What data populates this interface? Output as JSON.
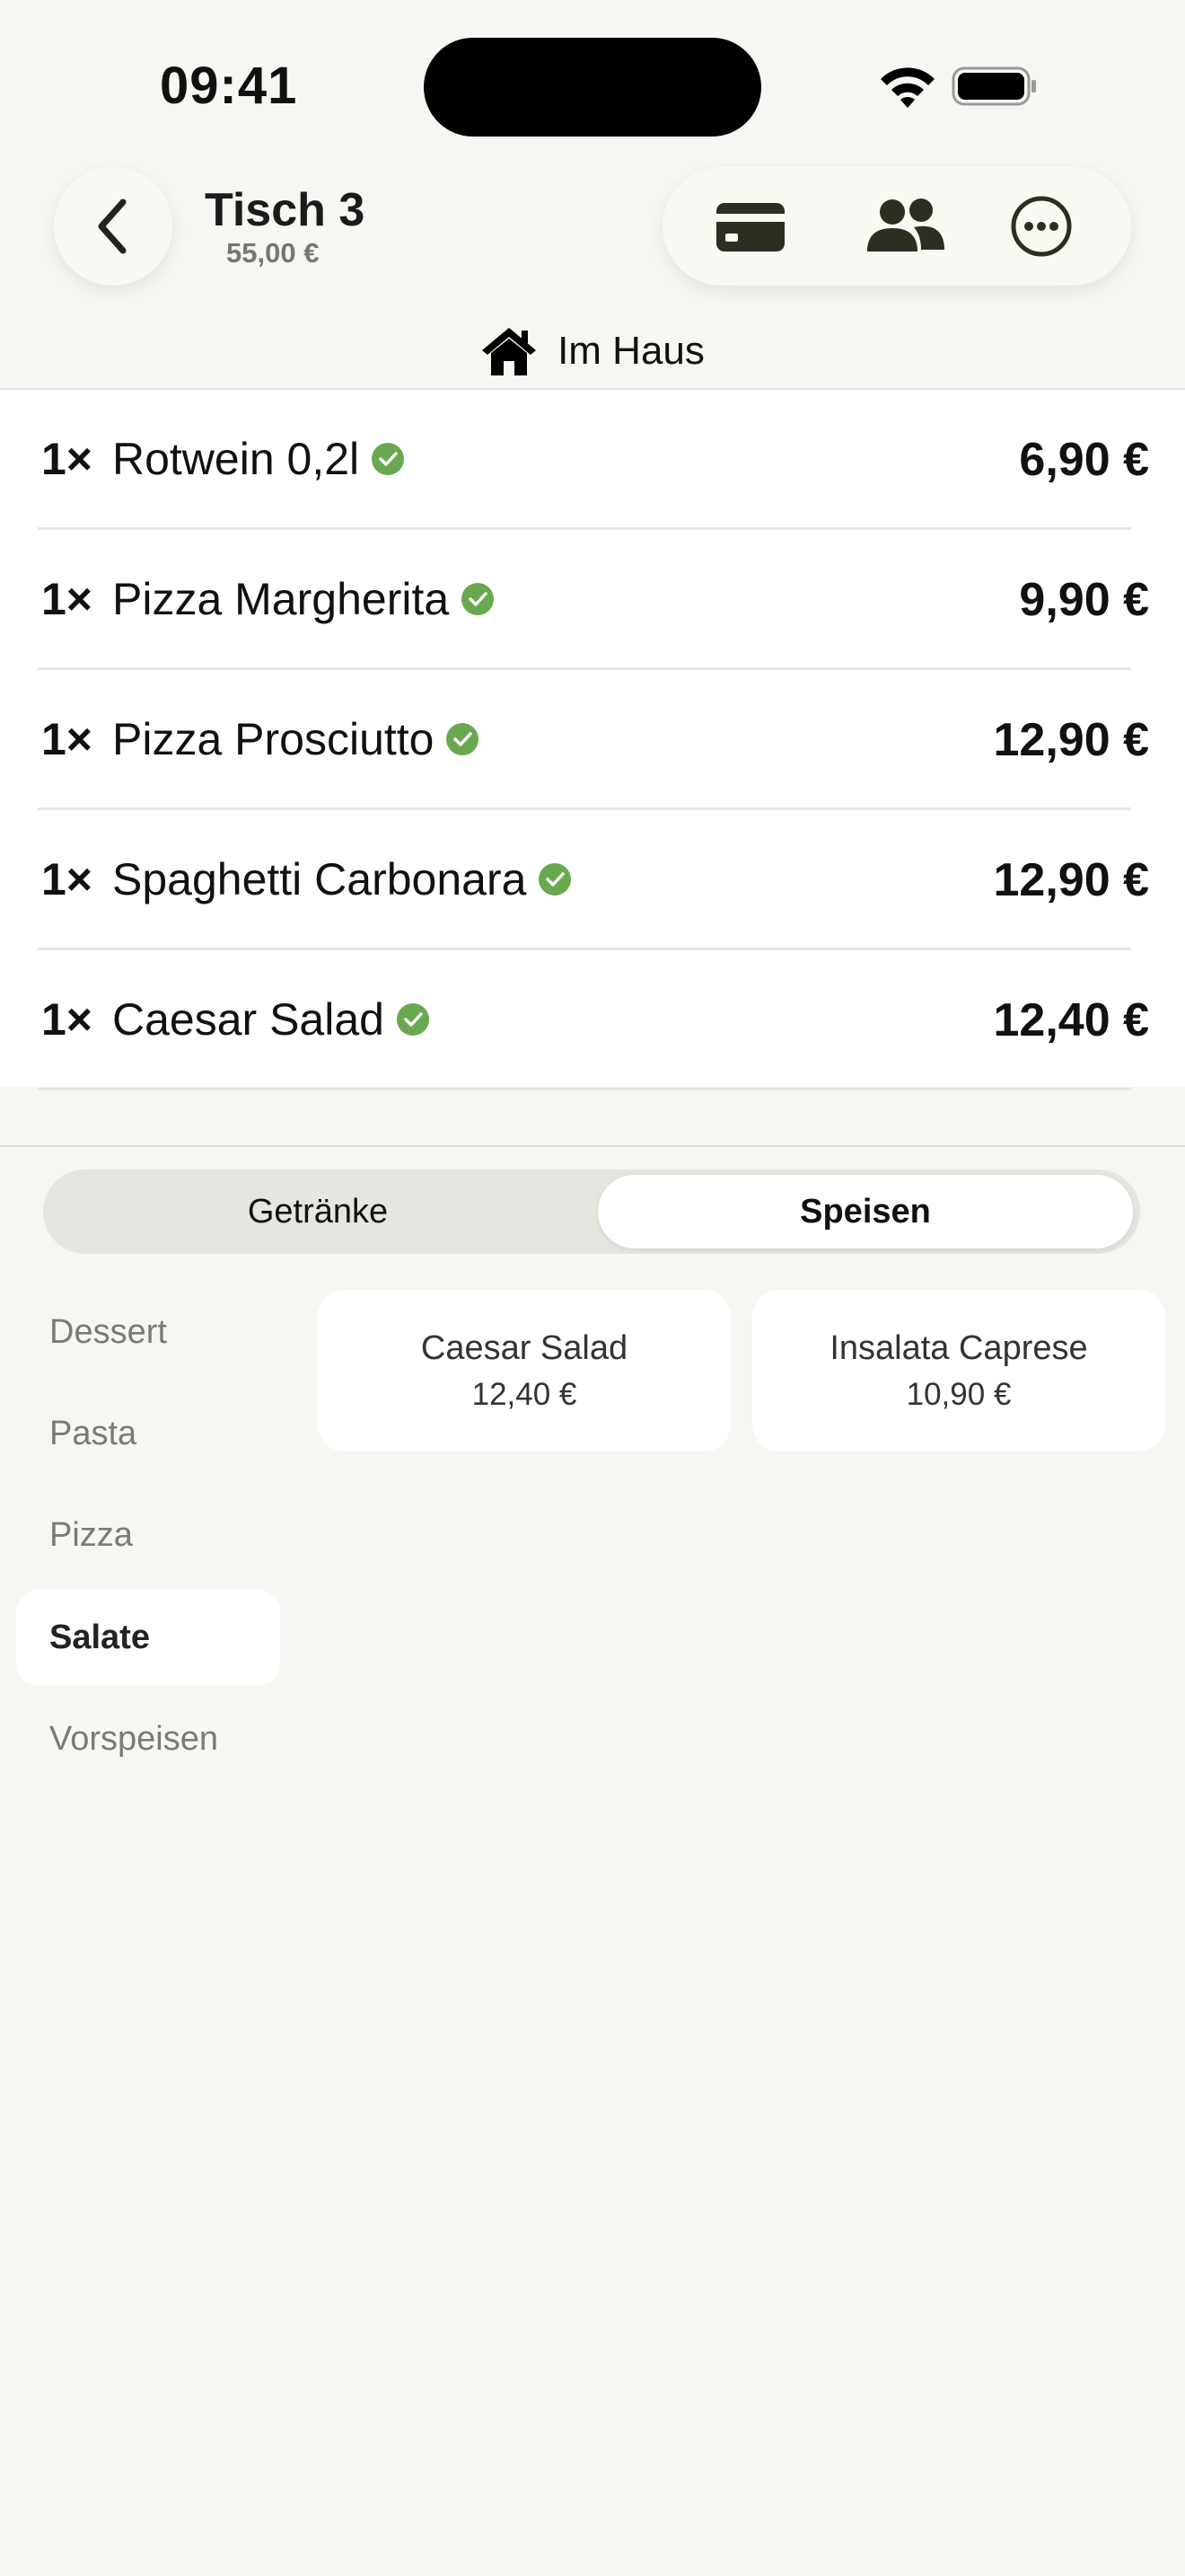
{
  "status": {
    "time": "09:41"
  },
  "header": {
    "title": "Tisch 3",
    "subtotal": "55,00 €",
    "location": "Im Haus"
  },
  "orders": [
    {
      "qty": "1×",
      "name": "Rotwein 0,2l",
      "price": "6,90 €"
    },
    {
      "qty": "1×",
      "name": "Pizza Margherita",
      "price": "9,90 €"
    },
    {
      "qty": "1×",
      "name": "Pizza Prosciutto",
      "price": "12,90 €"
    },
    {
      "qty": "1×",
      "name": "Spaghetti Carbonara",
      "price": "12,90 €"
    },
    {
      "qty": "1×",
      "name": "Caesar Salad",
      "price": "12,40 €"
    }
  ],
  "segments": [
    "Getränke",
    "Speisen"
  ],
  "categories": [
    "Dessert",
    "Pasta",
    "Pizza",
    "Salate",
    "Vorspeisen"
  ],
  "products": [
    {
      "name": "Caesar Salad",
      "price": "12,40 €"
    },
    {
      "name": "Insalata Caprese",
      "price": "10,90 €"
    }
  ],
  "icons": {
    "back": "chevron-left-icon",
    "payment": "credit-card-icon",
    "split": "people-icon",
    "more": "ellipsis-circle-icon",
    "location": "house-icon",
    "confirmed": "checkmark-circle-icon"
  },
  "colors": {
    "background": "#f7f6f2",
    "accent_dark": "#2d2d21",
    "confirmed_green": "#6aa84f",
    "muted_text": "#7b7a74"
  }
}
